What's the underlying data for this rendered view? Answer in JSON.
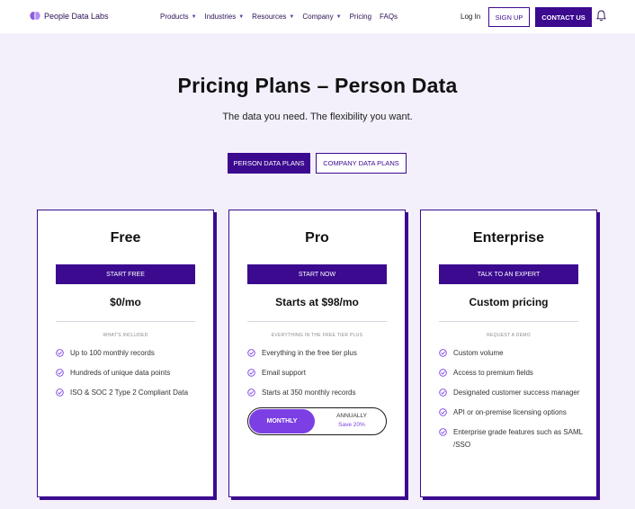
{
  "nav": {
    "brand": "People Data Labs",
    "menu": [
      {
        "label": "Products",
        "dropdown": true
      },
      {
        "label": "Industries",
        "dropdown": true
      },
      {
        "label": "Resources",
        "dropdown": true
      },
      {
        "label": "Company",
        "dropdown": true
      },
      {
        "label": "Pricing",
        "dropdown": false
      },
      {
        "label": "FAQs",
        "dropdown": false
      }
    ],
    "login": "Log In",
    "signup": "SIGN UP",
    "contact": "CONTACT US",
    "icons": {
      "logo": "brain-icon",
      "notifications": "bell-icon",
      "caret": "caret-down-icon",
      "check": "check-circle-icon"
    }
  },
  "hero": {
    "title": "Pricing Plans – Person Data",
    "subtitle": "The data you need. The flexibility you want."
  },
  "tabs": {
    "active": "PERSON DATA PLANS",
    "inactive": "COMPANY DATA PLANS"
  },
  "colors": {
    "brand": "#3b0a8f",
    "accent": "#7b3fe4",
    "page_bg": "#f3f0fc"
  },
  "plans": [
    {
      "name": "Free",
      "cta": "START FREE",
      "price": "$0/mo",
      "caption": "WHAT'S INCLUDED",
      "features": [
        "Up to 100 monthly records",
        "Hundreds of unique data points",
        "ISO & SOC 2 Type 2 Compliant Data"
      ]
    },
    {
      "name": "Pro",
      "cta": "START NOW",
      "price": "Starts at $98/mo",
      "caption": "EVERYTHING IN THE FREE TIER PLUS",
      "features": [
        "Everything in the free tier plus",
        "Email support",
        "Starts at 350 monthly records"
      ],
      "billing_toggle": {
        "selected": "MONTHLY",
        "other": "ANNUALLY",
        "other_note": "Save 20%"
      }
    },
    {
      "name": "Enterprise",
      "cta": "TALK TO AN EXPERT",
      "price": "Custom pricing",
      "caption": "REQUEST A DEMO",
      "features": [
        "Custom volume",
        "Access to premium fields",
        "Designated customer success manager",
        "API or on-premise licensing options",
        "Enterprise grade features such as SAML /SSO"
      ]
    }
  ]
}
